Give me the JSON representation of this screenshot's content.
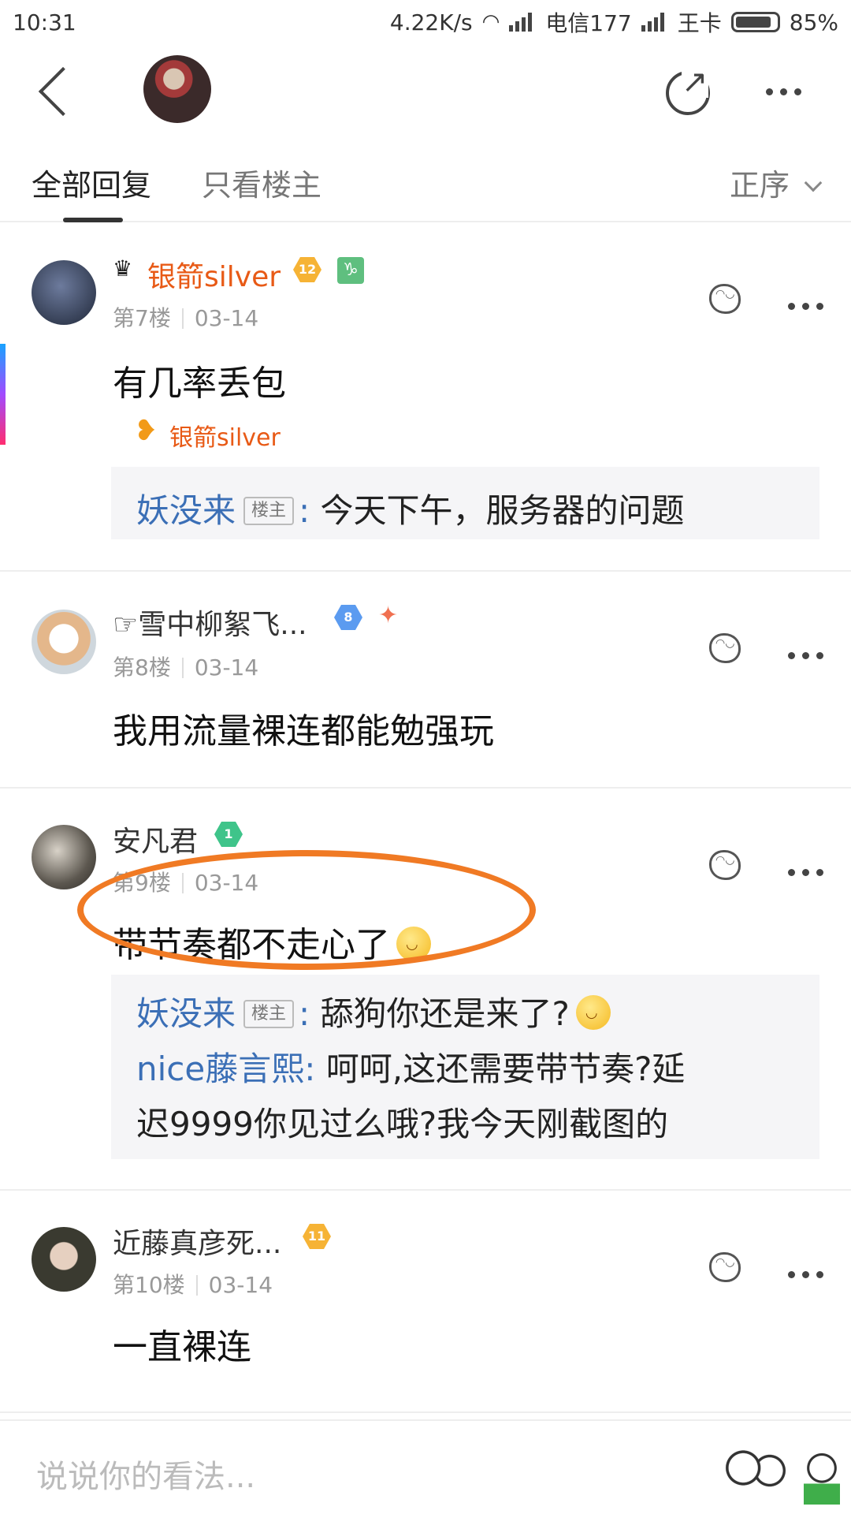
{
  "status_bar": {
    "time": "10:31",
    "speed": "4.22K/s",
    "carrier1": "电信177",
    "carrier2": "王卡",
    "battery": "85%"
  },
  "tabs": {
    "all": "全部回复",
    "op_only": "只看楼主",
    "sort": "正序"
  },
  "posts": [
    {
      "username": "银箭silver",
      "level": "12",
      "floor": "第7楼",
      "date": "03-14",
      "content": "有几率丢包",
      "sub_user": "银箭silver",
      "replies": [
        {
          "name": "妖没来",
          "tag": "楼主",
          "text": "今天下午，服务器的问题"
        }
      ]
    },
    {
      "username": "☞雪中柳絮飞...",
      "level": "8",
      "floor": "第8楼",
      "date": "03-14",
      "content": "我用流量裸连都能勉强玩"
    },
    {
      "username": "安凡君",
      "level": "1",
      "floor": "第9楼",
      "date": "03-14",
      "content": "带节奏都不走心了",
      "replies": [
        {
          "name": "妖没来",
          "tag": "楼主",
          "text": "舔狗你还是来了?"
        },
        {
          "name": "nice藤言熙",
          "text": "呵呵,这还需要带节奏?延"
        },
        {
          "text": "迟9999你见过么哦?我今天刚截图的"
        }
      ]
    },
    {
      "username": "近藤真彦死...",
      "level": "11",
      "floor": "第10楼",
      "date": "03-14",
      "content": "一直裸连"
    }
  ],
  "input": {
    "placeholder": "说说你的看法..."
  },
  "colors": {
    "accent_orange": "#e85a16",
    "reply_name_blue": "#3b6fb6",
    "highlight_orange": "#f07a24"
  }
}
